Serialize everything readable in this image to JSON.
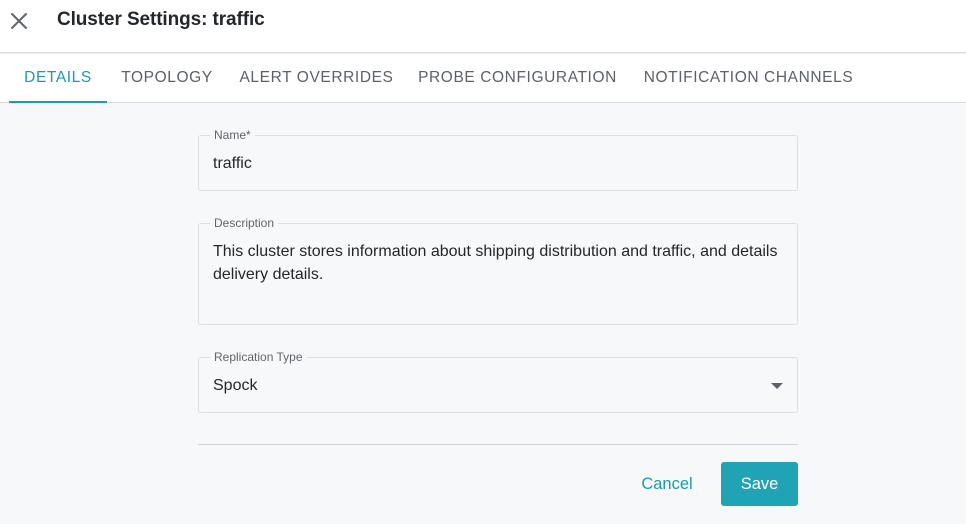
{
  "header": {
    "close_icon": "close-icon",
    "title": "Cluster Settings: traffic"
  },
  "tabs": [
    {
      "label": "DETAILS",
      "active": true
    },
    {
      "label": "TOPOLOGY",
      "active": false
    },
    {
      "label": "ALERT OVERRIDES",
      "active": false
    },
    {
      "label": "PROBE CONFIGURATION",
      "active": false
    },
    {
      "label": "NOTIFICATION CHANNELS",
      "active": false
    }
  ],
  "form": {
    "name": {
      "label": "Name",
      "required_marker": "*",
      "value": "traffic"
    },
    "description": {
      "label": "Description",
      "value": "This cluster stores information about shipping distribution and traffic, and details delivery details."
    },
    "replication_type": {
      "label": "Replication Type",
      "value": "Spock",
      "icon": "chevron-down-icon"
    }
  },
  "actions": {
    "cancel_label": "Cancel",
    "save_label": "Save"
  },
  "colors": {
    "accent": "#1a9bae",
    "save_button": "#1fa3b5",
    "background": "#f7f8f9"
  }
}
